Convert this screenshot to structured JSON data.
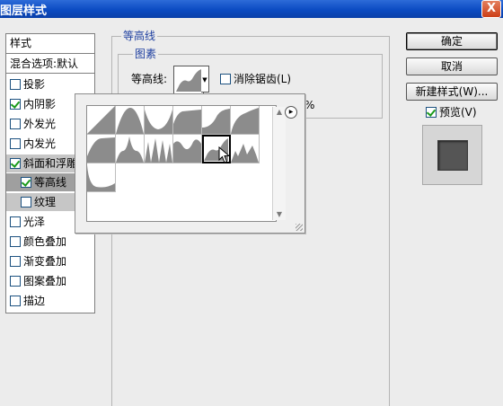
{
  "window": {
    "title": "图层样式",
    "close_symbol": "X"
  },
  "left_panel": {
    "header": "样式",
    "blending": "混合选项:默认",
    "items": [
      {
        "label": "投影",
        "checked": false
      },
      {
        "label": "内阴影",
        "checked": true
      },
      {
        "label": "外发光",
        "checked": false
      },
      {
        "label": "内发光",
        "checked": false
      },
      {
        "label": "斜面和浮雕",
        "checked": true
      },
      {
        "label": "等高线",
        "checked": true
      },
      {
        "label": "纹理",
        "checked": false
      },
      {
        "label": "光泽",
        "checked": false
      },
      {
        "label": "颜色叠加",
        "checked": false
      },
      {
        "label": "渐变叠加",
        "checked": false
      },
      {
        "label": "图案叠加",
        "checked": false
      },
      {
        "label": "描边",
        "checked": false
      }
    ]
  },
  "main": {
    "section_title": "等高线",
    "group_title": "图素",
    "contour_label": "等高线:",
    "anti_alias_label": "消除锯齿(L)",
    "anti_alias_checked": false,
    "percent_text": "%"
  },
  "picker": {
    "thumbnail_icons": [
      "linear-contour-icon",
      "cone-contour-icon",
      "cove-deep-contour-icon",
      "cove-shallow-contour-icon",
      "gaussian-contour-icon",
      "half-round-contour-icon",
      "ring-contour-icon",
      "ring-double-contour-icon",
      "rolling-slope-contour-icon",
      "rounded-steps-contour-icon",
      "sawtooth-contour-icon",
      "cone-inverted-contour-icon",
      "ring-triple-contour-icon"
    ],
    "selected_index": 10,
    "menu_arrow": "▶"
  },
  "buttons": {
    "ok": "确定",
    "cancel": "取消",
    "new_style": "新建样式(W)...",
    "preview_label": "预览(V)",
    "preview_checked": true
  },
  "colors": {
    "title_bar": "#0b4bc2",
    "group_title": "#1e3fa0",
    "contour_fill": "#8c8c8c",
    "preview_swatch": "#555555"
  }
}
